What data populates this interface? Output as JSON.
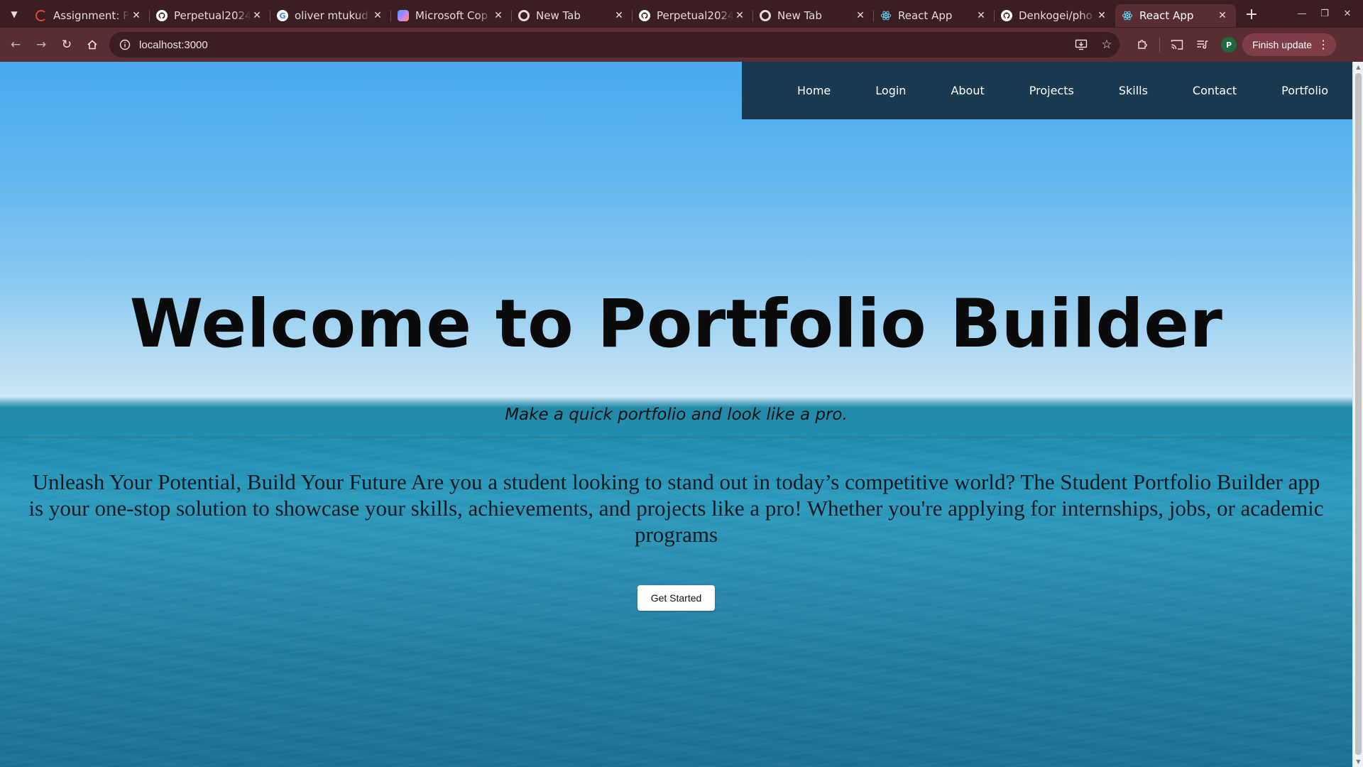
{
  "browser": {
    "tabs": [
      {
        "title": "Assignment: P",
        "icon": "loading-spinner-icon",
        "icon_color": "#e2453c",
        "active": false
      },
      {
        "title": "Perpetual2024",
        "icon": "github-icon",
        "icon_color": "#ffffff",
        "active": false
      },
      {
        "title": "oliver mtukud",
        "icon": "google-icon",
        "icon_color": "#4285f4",
        "active": false
      },
      {
        "title": "Microsoft Cop",
        "icon": "copilot-icon",
        "icon_color": "#c77dff",
        "active": false
      },
      {
        "title": "New Tab",
        "icon": "chrome-icon",
        "icon_color": "#e8d9da",
        "active": false
      },
      {
        "title": "Perpetual2024",
        "icon": "github-icon",
        "icon_color": "#ffffff",
        "active": false
      },
      {
        "title": "New Tab",
        "icon": "chrome-icon",
        "icon_color": "#e8d9da",
        "active": false
      },
      {
        "title": "React App",
        "icon": "react-icon",
        "icon_color": "#61dafb",
        "active": false
      },
      {
        "title": "Denkogei/pho",
        "icon": "github-icon",
        "icon_color": "#ffffff",
        "active": false
      },
      {
        "title": "React App",
        "icon": "react-icon",
        "icon_color": "#61dafb",
        "active": true
      }
    ],
    "address": "localhost:3000",
    "update_label": "Finish update",
    "profile_initial": "P"
  },
  "page": {
    "nav": [
      "Home",
      "Login",
      "About",
      "Projects",
      "Skills",
      "Contact",
      "Portfolio"
    ],
    "title": "Welcome to Portfolio Builder",
    "subtitle": "Make a quick portfolio and look like a pro.",
    "body": "Unleash Your Potential, Build Your Future Are you a student looking to stand out in today’s competitive world? The Student Portfolio Builder app is your one-stop solution to showcase your skills, achievements, and projects like a pro! Whether you're applying for internships, jobs, or academic programs",
    "cta_label": "Get Started"
  },
  "colors": {
    "nav_background": "#1a3a52",
    "tab_strip": "#3a1e22",
    "toolbar": "#5a2d33"
  }
}
